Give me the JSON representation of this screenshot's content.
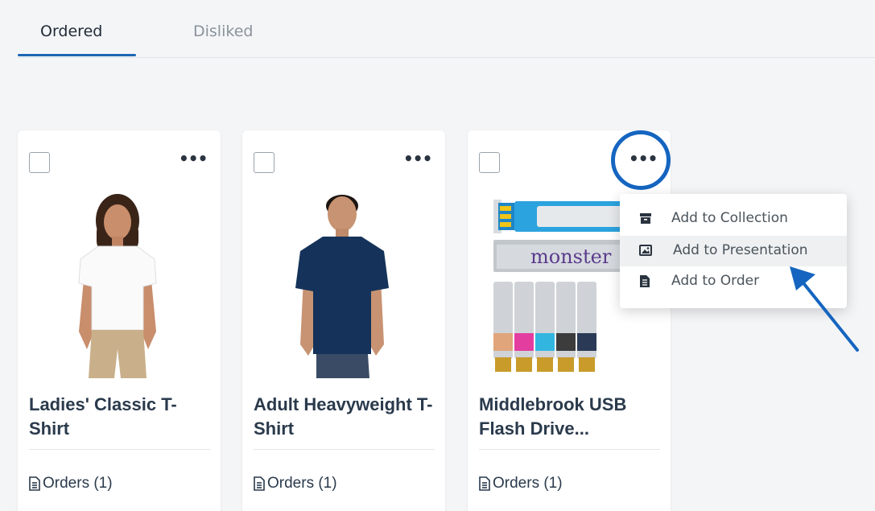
{
  "tabs": [
    {
      "label": "Ordered",
      "active": true
    },
    {
      "label": "Disliked",
      "active": false
    }
  ],
  "products": [
    {
      "title": "Ladies' Classic T-Shirt",
      "orders_label": "Orders (1)",
      "image": "white-t-shirt-woman"
    },
    {
      "title": "Adult Heavyweight T-Shirt",
      "orders_label": "Orders (1)",
      "image": "navy-t-shirt-man"
    },
    {
      "title": "Middlebrook USB Flash Drive...",
      "orders_label": "Orders (1)",
      "image": "usb-flash-drives",
      "brand_text": "monster"
    }
  ],
  "context_menu": {
    "items": [
      {
        "label": "Add to Collection",
        "icon": "archive-box-icon"
      },
      {
        "label": "Add to Presentation",
        "icon": "image-icon"
      },
      {
        "label": "Add to Order",
        "icon": "document-icon"
      }
    ]
  },
  "colors": {
    "accent": "#1e66b3",
    "annotation": "#1565c0",
    "title_text": "#2a3a4c",
    "background": "#f4f5f7"
  }
}
